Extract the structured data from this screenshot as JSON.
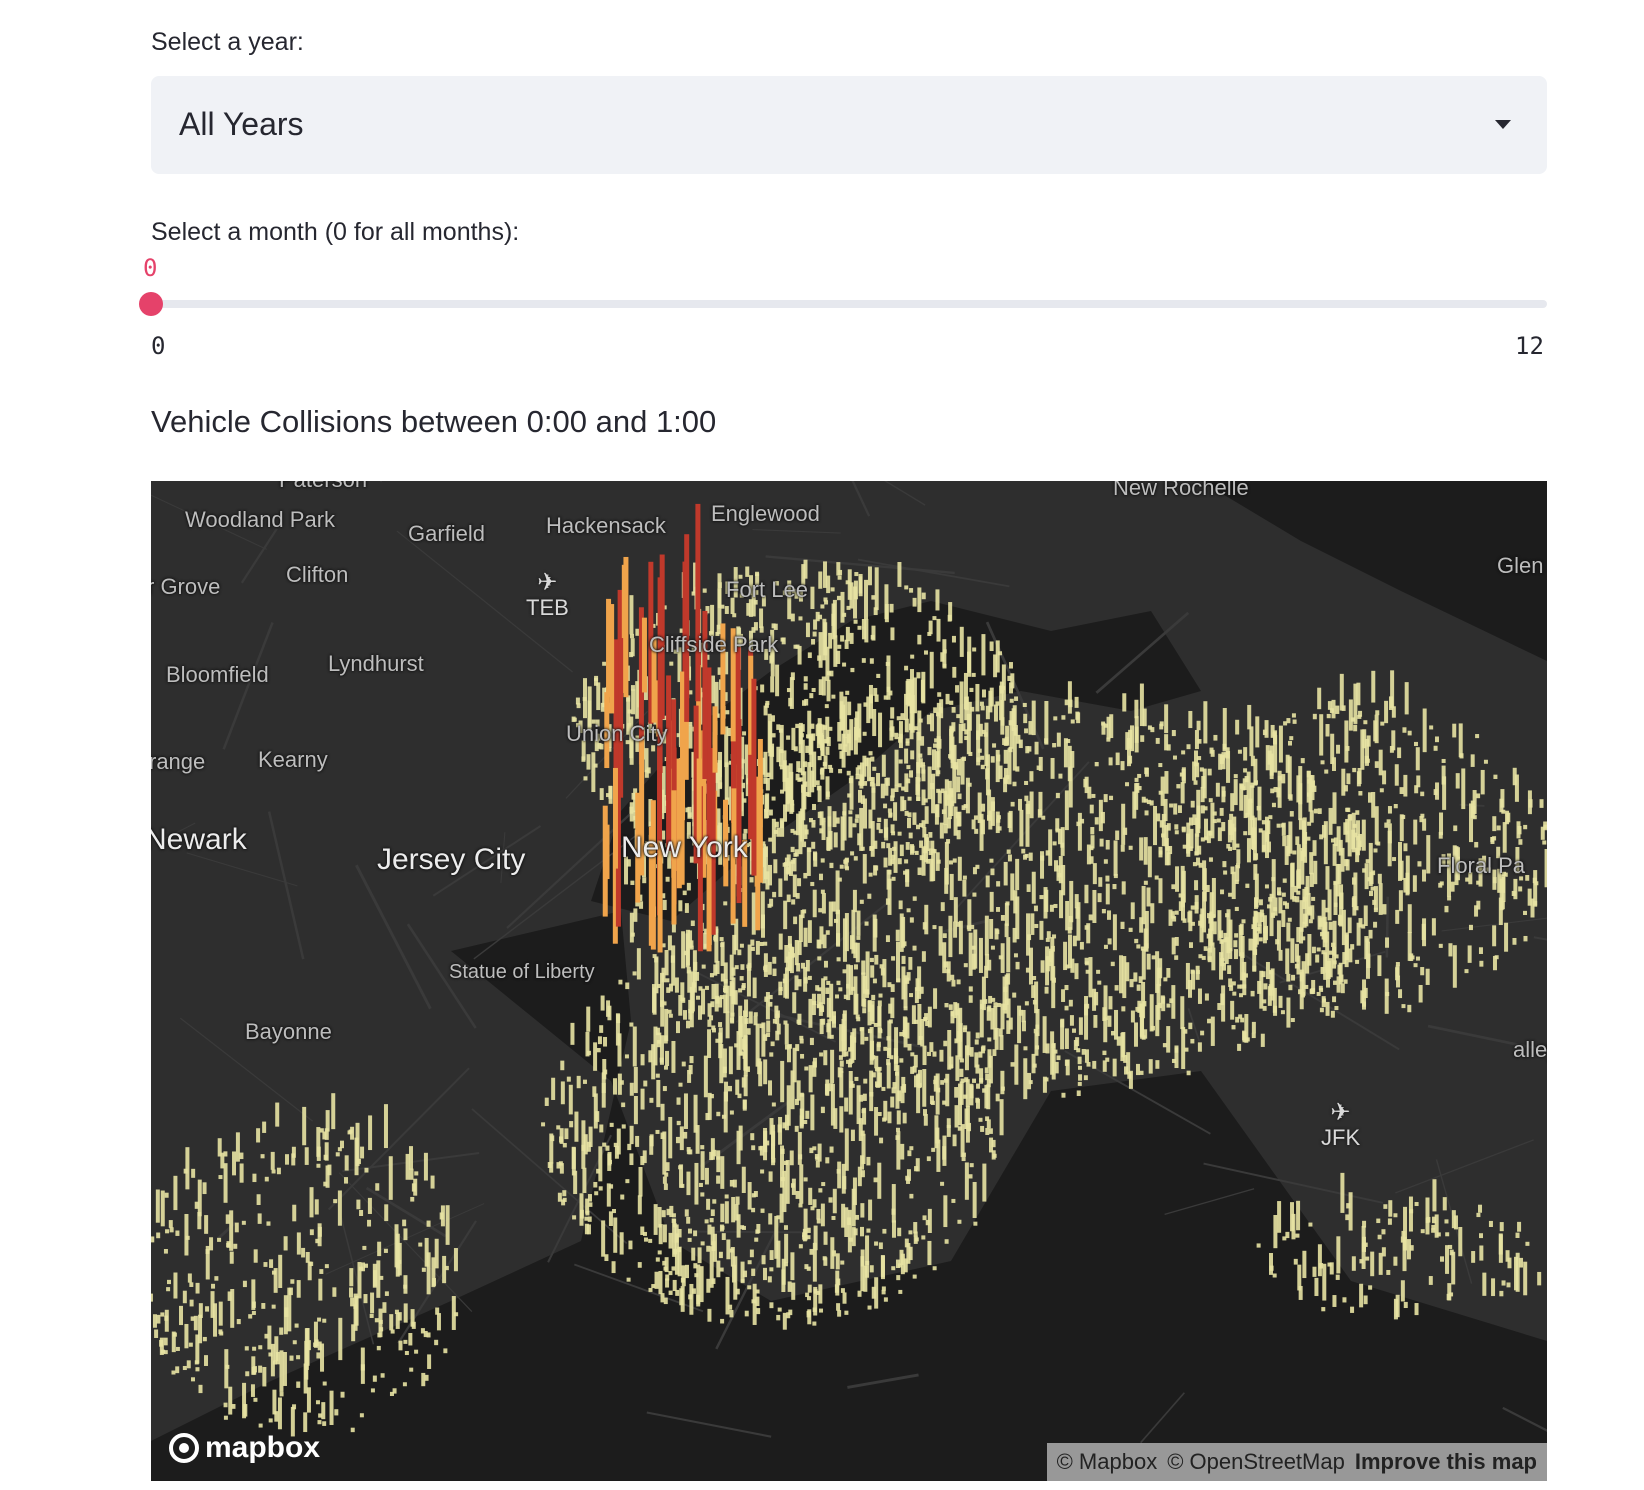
{
  "year_select": {
    "label": "Select a year:",
    "value": "All Years"
  },
  "month_slider": {
    "label": "Select a month (0 for all months):",
    "value": "0",
    "min": "0",
    "max": "12"
  },
  "map": {
    "title": "Vehicle Collisions between 0:00 and 1:00",
    "places": [
      {
        "id": "paterson",
        "text": "Paterson"
      },
      {
        "id": "woodland-park",
        "text": "Woodland Park"
      },
      {
        "id": "garfield",
        "text": "Garfield"
      },
      {
        "id": "hackensack",
        "text": "Hackensack"
      },
      {
        "id": "englewood",
        "text": "Englewood"
      },
      {
        "id": "new-rochelle",
        "text": "New Rochelle"
      },
      {
        "id": "glen",
        "text": "Glen"
      },
      {
        "id": "grove",
        "text": "r Grove"
      },
      {
        "id": "clifton",
        "text": "Clifton"
      },
      {
        "id": "fort-lee",
        "text": "Fort Lee"
      },
      {
        "id": "cliffside",
        "text": "Cliffside Park"
      },
      {
        "id": "bloomfield",
        "text": "Bloomfield"
      },
      {
        "id": "lyndhurst",
        "text": "Lyndhurst"
      },
      {
        "id": "union-city",
        "text": "Union City"
      },
      {
        "id": "orange",
        "text": "range"
      },
      {
        "id": "kearny",
        "text": "Kearny"
      },
      {
        "id": "newark",
        "text": "Newark"
      },
      {
        "id": "jersey-city",
        "text": "Jersey City"
      },
      {
        "id": "new-york",
        "text": "New York"
      },
      {
        "id": "floral-park",
        "text": "Floral Pa"
      },
      {
        "id": "statue",
        "text": "Statue of Liberty"
      },
      {
        "id": "bayonne",
        "text": "Bayonne"
      },
      {
        "id": "valley",
        "text": "alley"
      }
    ],
    "airports": [
      {
        "id": "teb",
        "code": "TEB"
      },
      {
        "id": "jfk",
        "code": "JFK"
      }
    ],
    "logo": "mapbox",
    "attribution": {
      "mapbox": "© Mapbox",
      "osm": "© OpenStreetMap",
      "improve": "Improve this map"
    },
    "colors": {
      "background": "#242424",
      "land": "#2e2e2e",
      "water": "#1c1c1c",
      "roads": "#3a3a3a",
      "bar_low": "#e8e3a3",
      "bar_mid": "#f0a44b",
      "bar_high": "#c0392b"
    }
  }
}
